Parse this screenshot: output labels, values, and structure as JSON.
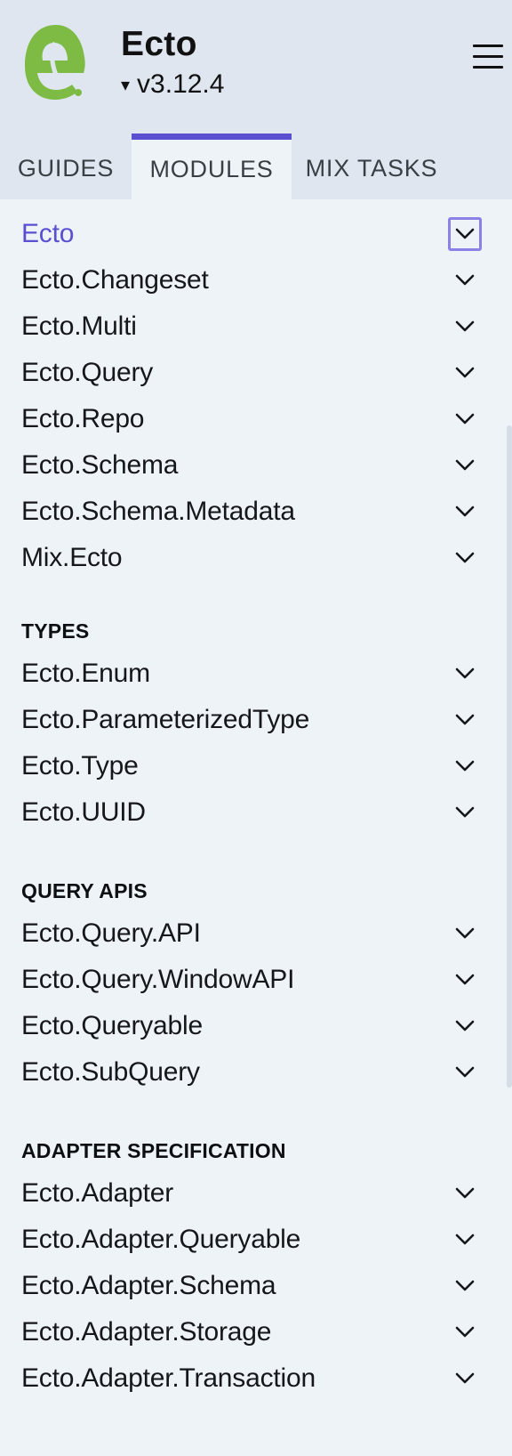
{
  "header": {
    "title": "Ecto",
    "version": "v3.12.4",
    "version_caret": "▾",
    "logo_icon": "ecto-logo",
    "menu_icon": "hamburger-menu-icon"
  },
  "tabs": [
    {
      "label": "GUIDES",
      "active": false
    },
    {
      "label": "MODULES",
      "active": true
    },
    {
      "label": "MIX TASKS",
      "active": false
    }
  ],
  "colors": {
    "accent": "#5a4fd1",
    "header_bg": "#dfe6ef",
    "content_bg": "#eef3f8",
    "logo_green": "#7dbb45"
  },
  "modules": [
    {
      "label": "Ecto",
      "active": true
    },
    {
      "label": "Ecto.Changeset"
    },
    {
      "label": "Ecto.Multi"
    },
    {
      "label": "Ecto.Query"
    },
    {
      "label": "Ecto.Repo"
    },
    {
      "label": "Ecto.Schema"
    },
    {
      "label": "Ecto.Schema.Metadata"
    },
    {
      "label": "Mix.Ecto"
    }
  ],
  "groups": [
    {
      "title": "TYPES",
      "items": [
        "Ecto.Enum",
        "Ecto.ParameterizedType",
        "Ecto.Type",
        "Ecto.UUID"
      ]
    },
    {
      "title": "QUERY APIS",
      "items": [
        "Ecto.Query.API",
        "Ecto.Query.WindowAPI",
        "Ecto.Queryable",
        "Ecto.SubQuery"
      ]
    },
    {
      "title": "ADAPTER SPECIFICATION",
      "items": [
        "Ecto.Adapter",
        "Ecto.Adapter.Queryable",
        "Ecto.Adapter.Schema",
        "Ecto.Adapter.Storage",
        "Ecto.Adapter.Transaction"
      ]
    }
  ]
}
